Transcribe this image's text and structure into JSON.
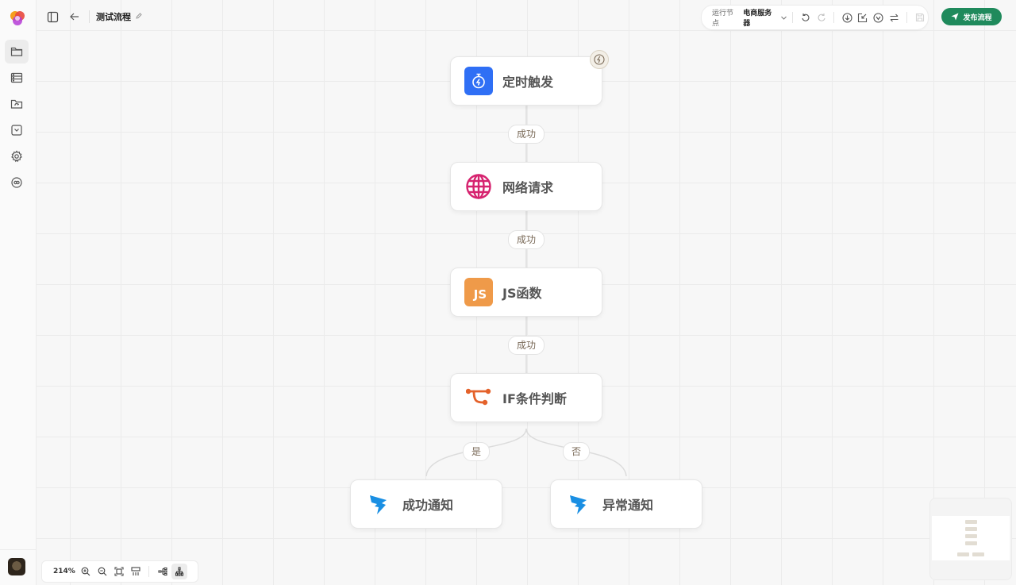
{
  "header": {
    "title": "测试流程",
    "run_node_label": "运行节点",
    "run_node_value": "电商服务器",
    "publish_label": "发布流程"
  },
  "sidebar": {
    "items": [
      {
        "name": "folder-icon"
      },
      {
        "name": "database-icon"
      },
      {
        "name": "folder-sync-icon"
      },
      {
        "name": "package-icon"
      },
      {
        "name": "gear-icon"
      },
      {
        "name": "plugin-icon"
      }
    ]
  },
  "flow": {
    "nodes": [
      {
        "id": "trigger",
        "label": "定时触发",
        "icon": "timer-bolt-icon",
        "color": "#2f6ff5"
      },
      {
        "id": "http",
        "label": "网络请求",
        "icon": "globe-icon",
        "color": "#d6236f"
      },
      {
        "id": "js",
        "label": "JS函数",
        "icon": "js-icon",
        "color": "#ef9a49"
      },
      {
        "id": "if",
        "label": "IF条件判断",
        "icon": "branch-icon",
        "color": "#e4622b"
      },
      {
        "id": "ok",
        "label": "成功通知",
        "icon": "dingtalk-icon",
        "color": "#1a8fe3"
      },
      {
        "id": "err",
        "label": "异常通知",
        "icon": "dingtalk-icon",
        "color": "#1a8fe3"
      }
    ],
    "edges": [
      {
        "from": "trigger",
        "to": "http",
        "label": "成功"
      },
      {
        "from": "http",
        "to": "js",
        "label": "成功"
      },
      {
        "from": "js",
        "to": "if",
        "label": "成功"
      },
      {
        "from": "if",
        "to": "ok",
        "label": "是"
      },
      {
        "from": "if",
        "to": "err",
        "label": "否"
      }
    ]
  },
  "controls": {
    "zoom": "214%"
  },
  "colors": {
    "accent": "#1f8a5c",
    "edge_label_text": "#7a6a58"
  }
}
